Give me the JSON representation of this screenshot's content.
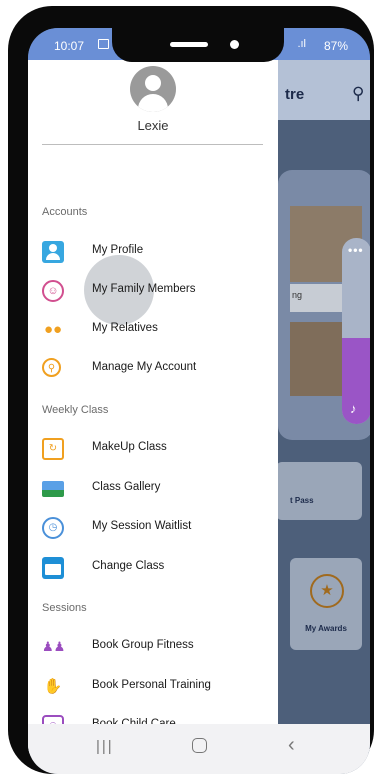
{
  "status_bar": {
    "time": "10:07",
    "signal": ".ıl",
    "battery": "87%"
  },
  "background_app": {
    "header_title": "tre",
    "tile_caption": "ng",
    "card_label": "t Pass",
    "awards_label": "My Awards"
  },
  "drawer": {
    "user_name": "Lexie",
    "sections": {
      "accounts": "Accounts",
      "weekly_class": "Weekly Class",
      "sessions": "Sessions"
    },
    "items": [
      {
        "label": "My Profile",
        "icon": "profile-icon"
      },
      {
        "label": "My Family Members",
        "icon": "family-icon"
      },
      {
        "label": "My Relatives",
        "icon": "relatives-icon"
      },
      {
        "label": "Manage My Account",
        "icon": "manage-account-icon"
      },
      {
        "label": "MakeUp Class",
        "icon": "makeup-calendar-icon"
      },
      {
        "label": "Class Gallery",
        "icon": "gallery-icon"
      },
      {
        "label": "My Session Waitlist",
        "icon": "clock-icon"
      },
      {
        "label": "Change Class",
        "icon": "calendar-icon"
      },
      {
        "label": "Book Group Fitness",
        "icon": "group-fitness-icon"
      },
      {
        "label": "Book Personal Training",
        "icon": "personal-training-icon"
      },
      {
        "label": "Book Child Care",
        "icon": "child-care-icon"
      }
    ]
  }
}
